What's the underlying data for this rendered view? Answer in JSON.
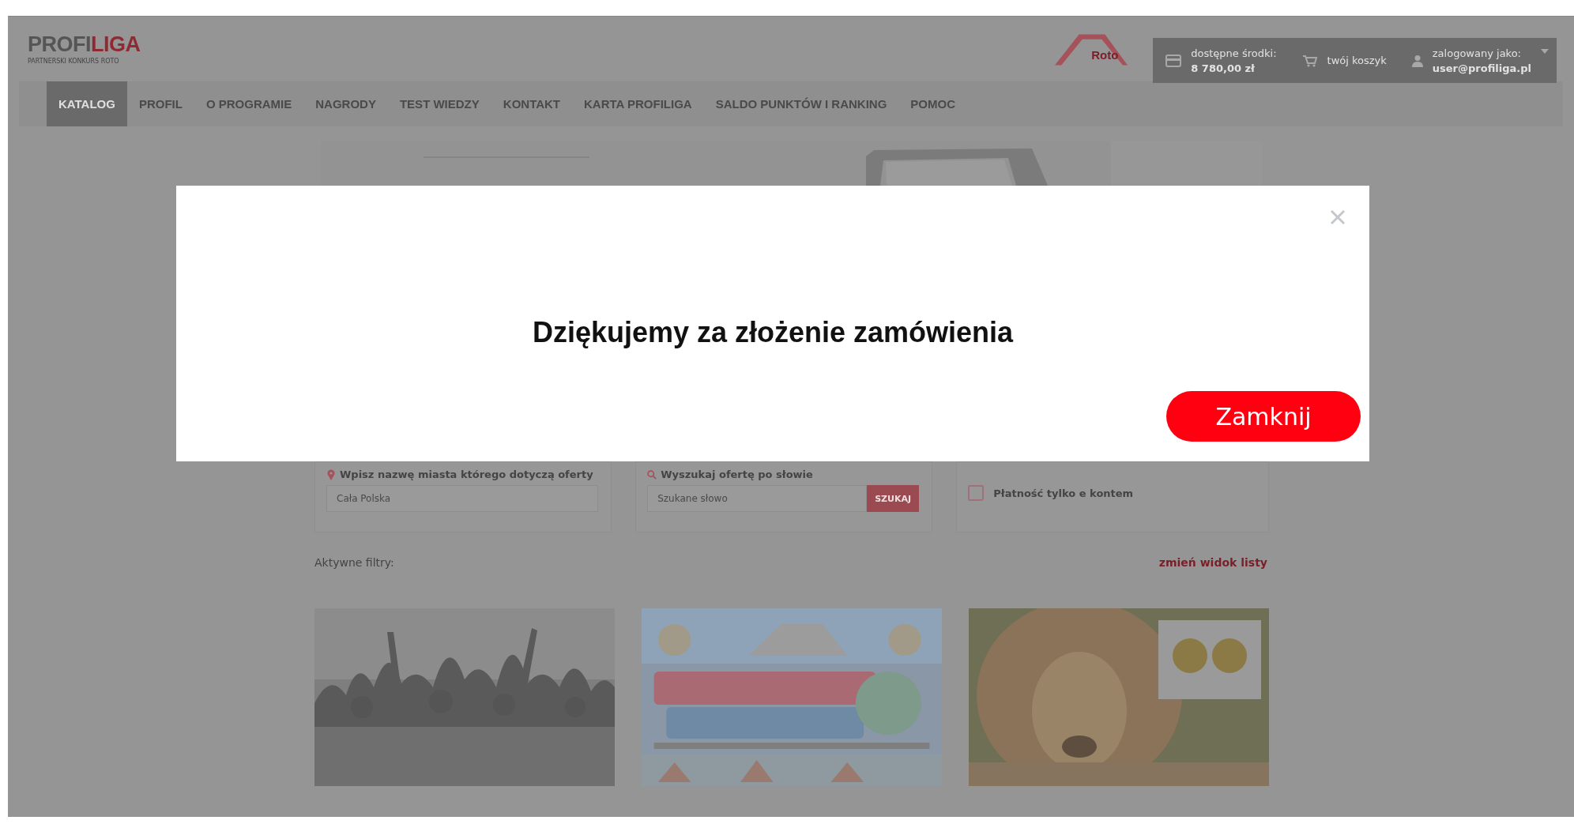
{
  "header": {
    "logo": {
      "part_1": "PROFI",
      "part_2": "LIGA",
      "tagline": "PARTNERSKI KONKURS ROTO"
    },
    "brand_logo": "Roto",
    "account": {
      "funds_label": "dostępne środki:",
      "funds": "8 780,00 zł",
      "cart": "twój koszyk",
      "user_label": "zalogowany jako:",
      "user": "user@profiliga.pl"
    }
  },
  "nav": [
    {
      "label": "KATALOG",
      "selected": true
    },
    {
      "label": "PROFIL",
      "selected": false
    },
    {
      "label": "O PROGRAMIE",
      "selected": false
    },
    {
      "label": "NAGRODY",
      "selected": false
    },
    {
      "label": "TEST WIEDZY",
      "selected": false
    },
    {
      "label": "KONTAKT",
      "selected": false
    },
    {
      "label": "KARTA PROFILIGA",
      "selected": false
    },
    {
      "label": "SALDO PUNKTÓW I RANKING",
      "selected": false
    },
    {
      "label": "POMOC",
      "selected": false
    }
  ],
  "filters": {
    "city": {
      "label": "Wpisz nazwę miasta którego dotyczą oferty",
      "placeholder": "Cała Polska"
    },
    "search": {
      "label": "Wyszukaj ofertę po słowie",
      "placeholder": "Szukane słowo",
      "button": "SZUKAJ"
    },
    "payment_only": {
      "label": "Płatność tylko e kontem",
      "checked": false
    }
  },
  "active_filters": "Aktywne filtry:",
  "change_view": "zmień widok listy",
  "modal": {
    "message": "Dziękujemy za złożenie zamówienia",
    "button": "Zamknij"
  }
}
